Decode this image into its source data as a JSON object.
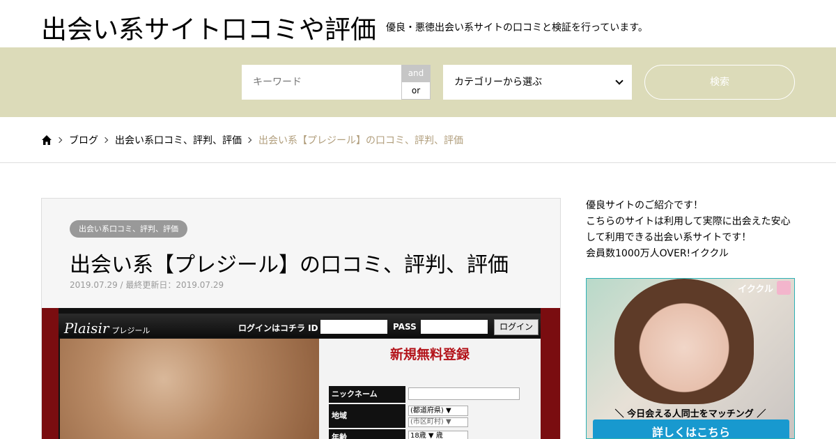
{
  "header": {
    "site_title": "出会い系サイト口コミや評価",
    "site_description": "優良・悪徳出会い系サイトの口コミと検証を行っています。"
  },
  "search": {
    "keyword_placeholder": "キーワード",
    "and_label": "and",
    "or_label": "or",
    "category_selected": "カテゴリーから選ぶ",
    "submit_label": "検索"
  },
  "breadcrumb": {
    "items": [
      "ブログ",
      "出会い系口コミ、評判、評価"
    ],
    "current": "出会い系【プレジール】の口コミ、評判、評価"
  },
  "article": {
    "category": "出会い系口コミ、評判、評価",
    "title": "出会い系【プレジール】の口コミ、評判、評価",
    "date": "2019.07.29 / 最終更新日：2019.07.29",
    "eyecatch": {
      "logo": "Plaisir",
      "logo_sub": "プレジール",
      "login_label": "ログインはコチラ ID",
      "pass_label": "PASS",
      "login_button": "ログイン",
      "form_title": "新規無料登録",
      "row_nickname": "ニックネーム",
      "row_region": "地域",
      "region_select_1": "(都道府県) ▼",
      "region_select_2": "(市区町村) ▼",
      "row_age": "年齢",
      "age_select": "18歳 ▼ 歳"
    }
  },
  "sidebar": {
    "lines": [
      "優良サイトのご紹介です！",
      "こちらのサイトは利用して実際に出会えた安心",
      "して利用できる出会い系サイトです！",
      "会員数1000万人OVER!イククル"
    ],
    "ad": {
      "brand": "イククル",
      "tagline": "＼ 今日会える人同士をマッチング ／",
      "cta": "詳しくはこちら"
    }
  },
  "colors": {
    "search_band": "#dcdbb9",
    "breadcrumb_current": "#b19e7c",
    "badge": "#999999",
    "cta": "#1899cf"
  }
}
